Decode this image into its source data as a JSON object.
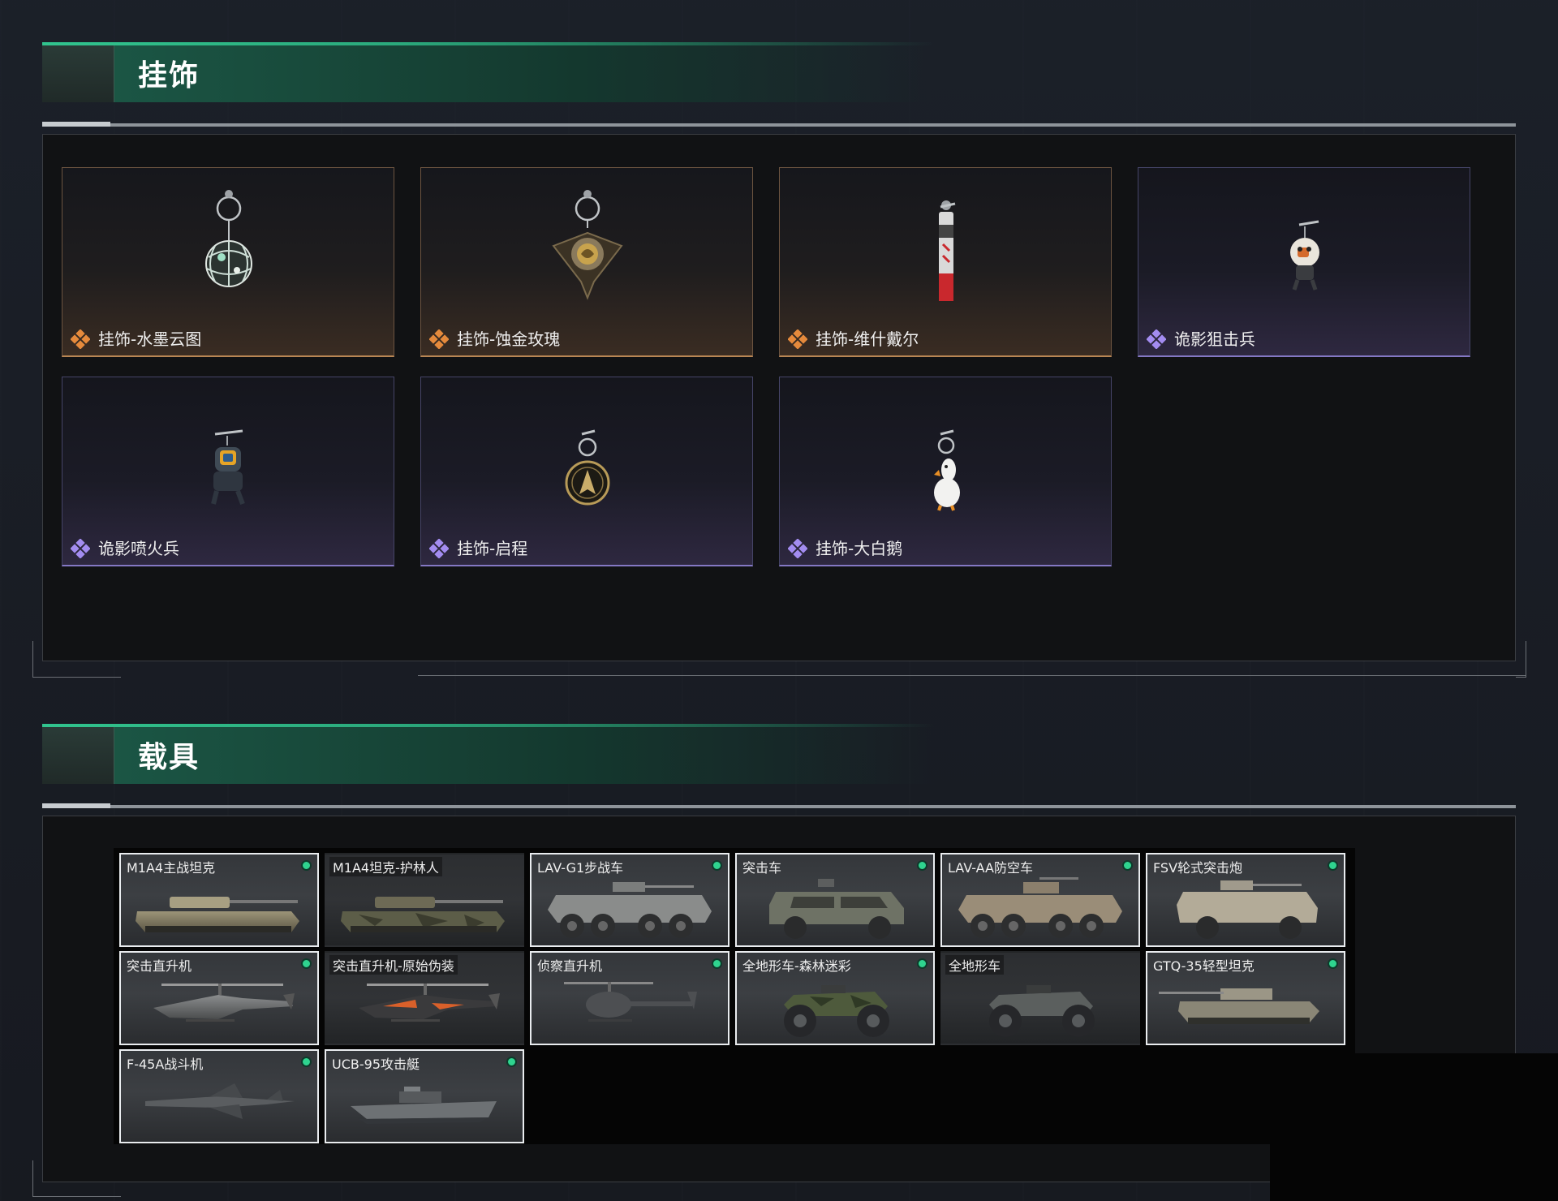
{
  "sections": {
    "charms": {
      "title": "挂饰"
    },
    "vehicles": {
      "title": "载具"
    }
  },
  "colors": {
    "accent_green": "#31c48e",
    "rarity_orange": "#e58a3c",
    "rarity_purple": "#a38cf0",
    "owned_dot": "#2fd48f"
  },
  "charms": [
    {
      "label": "挂饰-水墨云图",
      "rarity": "orange",
      "icon": "globe-charm-icon"
    },
    {
      "label": "挂饰-蚀金玫瑰",
      "rarity": "orange",
      "icon": "rose-charm-icon"
    },
    {
      "label": "挂饰-维什戴尔",
      "rarity": "orange",
      "icon": "tag-charm-icon"
    },
    {
      "label": "诡影狙击兵",
      "rarity": "purple",
      "icon": "sniper-figure-charm-icon"
    },
    {
      "label": "诡影喷火兵",
      "rarity": "purple",
      "icon": "flamethrower-figure-charm-icon"
    },
    {
      "label": "挂饰-启程",
      "rarity": "purple",
      "icon": "medallion-charm-icon"
    },
    {
      "label": "挂饰-大白鹅",
      "rarity": "purple",
      "icon": "goose-charm-icon"
    }
  ],
  "vehicles": [
    {
      "label": "M1A4主战坦克",
      "owned": true,
      "icon": "tank-icon"
    },
    {
      "label": "M1A4坦克-护林人",
      "owned": false,
      "icon": "tank-camo-icon"
    },
    {
      "label": "LAV-G1步战车",
      "owned": true,
      "icon": "ifv-icon"
    },
    {
      "label": "突击车",
      "owned": true,
      "icon": "assault-car-icon"
    },
    {
      "label": "LAV-AA防空车",
      "owned": true,
      "icon": "aa-vehicle-icon"
    },
    {
      "label": "FSV轮式突击炮",
      "owned": true,
      "icon": "wheeled-gun-icon"
    },
    {
      "label": "突击直升机",
      "owned": true,
      "icon": "attack-helicopter-icon"
    },
    {
      "label": "突击直升机-原始伪装",
      "owned": false,
      "icon": "attack-helicopter-camo-icon"
    },
    {
      "label": "侦察直升机",
      "owned": true,
      "icon": "scout-helicopter-icon"
    },
    {
      "label": "全地形车-森林迷彩",
      "owned": true,
      "icon": "atv-camo-icon"
    },
    {
      "label": "全地形车",
      "owned": false,
      "icon": "atv-icon"
    },
    {
      "label": "GTQ-35轻型坦克",
      "owned": true,
      "icon": "light-tank-icon"
    },
    {
      "label": "F-45A战斗机",
      "owned": true,
      "icon": "fighter-jet-icon"
    },
    {
      "label": "UCB-95攻击艇",
      "owned": true,
      "icon": "attack-boat-icon"
    }
  ]
}
